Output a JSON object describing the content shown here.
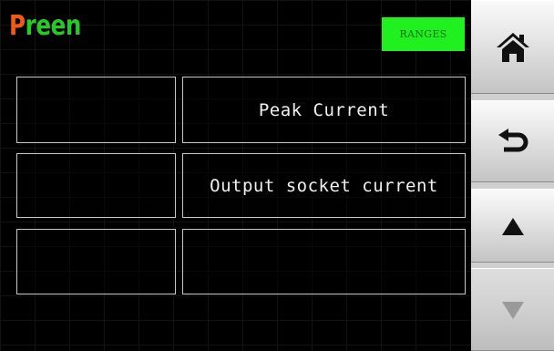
{
  "header": {
    "logo_first": "P",
    "logo_rest": "reen",
    "ranges_label": "RANGES"
  },
  "grid": {
    "rows": [
      {
        "left": "",
        "right": "Peak Current"
      },
      {
        "left": "",
        "right": "Output socket current"
      },
      {
        "left": "",
        "right": ""
      }
    ]
  },
  "sidebar": {
    "buttons": [
      {
        "name": "home",
        "icon": "home-icon"
      },
      {
        "name": "back",
        "icon": "return-arrow-icon"
      },
      {
        "name": "scroll-up",
        "icon": "triangle-up-icon"
      },
      {
        "name": "scroll-down",
        "icon": "triangle-down-icon",
        "state": "disabled"
      }
    ]
  },
  "colors": {
    "logo_orange": "#f05a14",
    "logo_green": "#28c828",
    "ranges_bg": "#20f020",
    "background": "#000000"
  }
}
